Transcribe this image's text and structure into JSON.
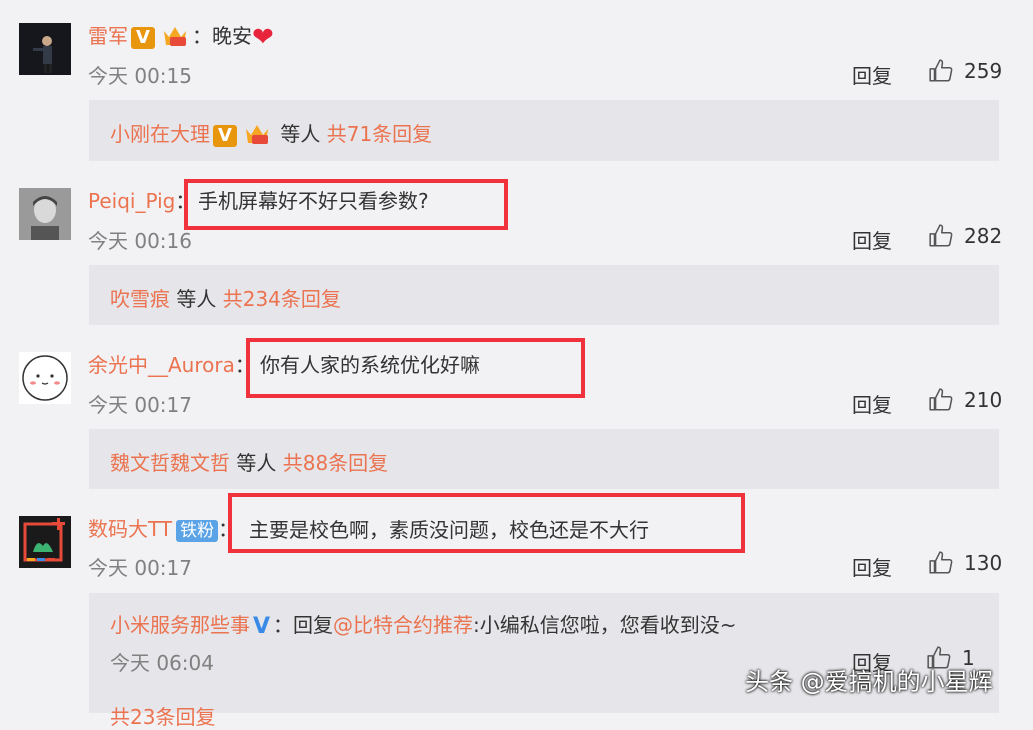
{
  "comments": [
    {
      "username": "雷军",
      "colon": "：",
      "text": "晚安",
      "time": "今天 00:15",
      "reply_label": "回复",
      "likes": "259",
      "sub_user": "小刚在大理",
      "sub_suffix": "等人",
      "sub_count": "共71条回复"
    },
    {
      "username": "Peiqi_Pig",
      "colon": "：",
      "text": "手机屏幕好不好只看参数?",
      "time": "今天 00:16",
      "reply_label": "回复",
      "likes": "282",
      "sub_user": "吹雪痕",
      "sub_suffix": "等人",
      "sub_count": "共234条回复"
    },
    {
      "username": "余光中__Aurora",
      "colon": "：",
      "text": "你有人家的系统优化好嘛",
      "time": "今天 00:17",
      "reply_label": "回复",
      "likes": "210",
      "sub_user": "魏文哲魏文哲",
      "sub_suffix": "等人",
      "sub_count": "共88条回复"
    },
    {
      "username": "数码大TT",
      "badge": "铁粉",
      "colon": "：",
      "text": "主要是校色啊，素质没问题，校色还是不大行",
      "time": "今天 00:17",
      "reply_label": "回复",
      "likes": "130",
      "sub_user": "小米服务那些事",
      "sub_reply_prefix": "回复",
      "sub_mention": "@比特合约推荐",
      "sub_text": ":小编私信您啦，您看收到没~",
      "sub_time": "今天 06:04",
      "sub_reply_label": "回复",
      "sub_likes": "1",
      "sub_count": "共23条回复"
    }
  ],
  "badges": {
    "v": "V"
  },
  "watermark": "头条 @爱搞机的小星辉",
  "colors": {
    "accent": "#eb7350",
    "highlight": "#f0323c",
    "background": "#f2f2f5",
    "subbox": "#e6e6ea"
  }
}
